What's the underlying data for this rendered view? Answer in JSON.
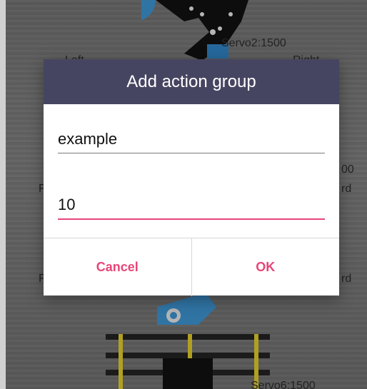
{
  "background": {
    "servo2_label": "Servo2:1500",
    "servo6_label": "Servo6:1500",
    "left_partial": "Left",
    "right_partial": "Right",
    "partial_right_1": "00",
    "partial_right_2": "rd",
    "partial_right_3": "rd",
    "partial_left_1": "F",
    "partial_left_2": "F"
  },
  "dialog": {
    "title": "Add action group",
    "name_value": "example",
    "count_value": "10",
    "cancel_label": "Cancel",
    "ok_label": "OK"
  },
  "colors": {
    "header_bg": "#464561",
    "accent": "#e8457a"
  }
}
